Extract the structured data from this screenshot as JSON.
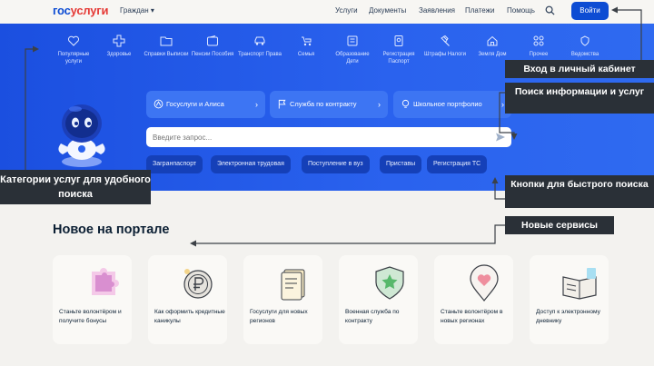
{
  "header": {
    "logo_part1": "гос",
    "logo_part2": "услуги",
    "region": "Граждан ▾",
    "nav": [
      "Услуги",
      "Документы",
      "Заявления",
      "Платежи",
      "Помощь"
    ],
    "login_label": "Войти"
  },
  "categories": [
    {
      "label": "Популярные услуги",
      "icon": "heart-icon"
    },
    {
      "label": "Здоровье",
      "icon": "health-cross-icon"
    },
    {
      "label": "Справки Выписки",
      "icon": "folder-icon"
    },
    {
      "label": "Пенсии Пособия",
      "icon": "wallet-icon"
    },
    {
      "label": "Транспорт Права",
      "icon": "car-icon"
    },
    {
      "label": "Семья",
      "icon": "stroller-icon"
    },
    {
      "label": "Образование Дети",
      "icon": "school-icon"
    },
    {
      "label": "Регистрация Паспорт",
      "icon": "passport-icon"
    },
    {
      "label": "Штрафы Налоги",
      "icon": "gavel-icon"
    },
    {
      "label": "Земля Дом",
      "icon": "house-icon"
    },
    {
      "label": "Прочее",
      "icon": "grid-icon"
    },
    {
      "label": "Ведомства",
      "icon": "emblem-icon"
    }
  ],
  "quick_links": [
    {
      "label": "Госуслуги и Алиса",
      "icon": "alice-icon"
    },
    {
      "label": "Служба по контракту",
      "icon": "flag-icon"
    },
    {
      "label": "Школьное портфолио",
      "icon": "lightbulb-icon"
    }
  ],
  "search": {
    "placeholder": "Введите запрос..."
  },
  "chips": [
    "Загранпаспорт",
    "Электронная трудовая",
    "Поступление в вуз",
    "Приставы",
    "Регистрация ТС"
  ],
  "new_section": {
    "title": "Новое на портале",
    "cards": [
      {
        "text": "Станьте волонтёром и получите бонусы",
        "icon": "puzzle-icon"
      },
      {
        "text": "Как оформить кредитные каникулы",
        "icon": "ruble-coin-icon"
      },
      {
        "text": "Госуслуги для новых регионов",
        "icon": "document-icon"
      },
      {
        "text": "Военная служба по контракту",
        "icon": "shield-star-icon"
      },
      {
        "text": "Станьте волонтёром в новых регионах",
        "icon": "heart-pin-icon"
      },
      {
        "text": "Доступ к электронному дневнику",
        "icon": "open-book-icon"
      }
    ]
  },
  "annotations": {
    "login": "Вход в личный кабинет",
    "search": "Поиск информации и услуг",
    "categories": "Категории услуг для удобного поиска",
    "quick_buttons": "Кнопки для быстрого поиска",
    "new_services": "Новые сервисы"
  },
  "colors": {
    "brand_blue": "#0d4cd3",
    "brand_red": "#e53935",
    "hero_blue": "#2a62ee",
    "annotation_bg": "#2a3037"
  }
}
